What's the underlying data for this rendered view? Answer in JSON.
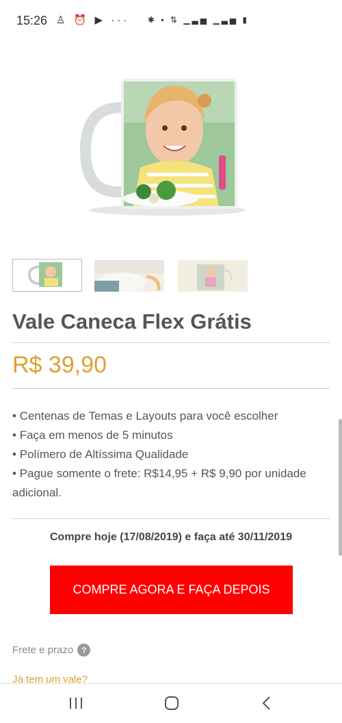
{
  "status_bar": {
    "time": "15:26",
    "left_icons": [
      "notification-icon",
      "alarm-icon",
      "youtube-icon",
      "more-icon"
    ],
    "right_icons": [
      "bluetooth-icon",
      "volte-icon",
      "4g-icon",
      "signal-icon",
      "signal-icon",
      "battery-icon"
    ]
  },
  "product": {
    "title": "Vale Caneca Flex Grátis",
    "price": "R$ 39,90",
    "features": [
      "Centenas de Temas e Layouts para você escolher",
      "Faça em menos de 5 minutos",
      "Polímero de Altíssima Qualidade",
      "Pague somente o frete: R$14,95 + R$ 9,90 por unidade adicional."
    ],
    "offer": "Compre hoje (17/08/2019) e faça até 30/11/2019",
    "cta_label": "COMPRE AGORA E FAÇA DEPOIS",
    "shipping_label": "Frete e prazo",
    "voucher_link": "Já tem um vale?"
  },
  "colors": {
    "price": "#e0a030",
    "cta": "#ff0000",
    "title": "#555555"
  }
}
